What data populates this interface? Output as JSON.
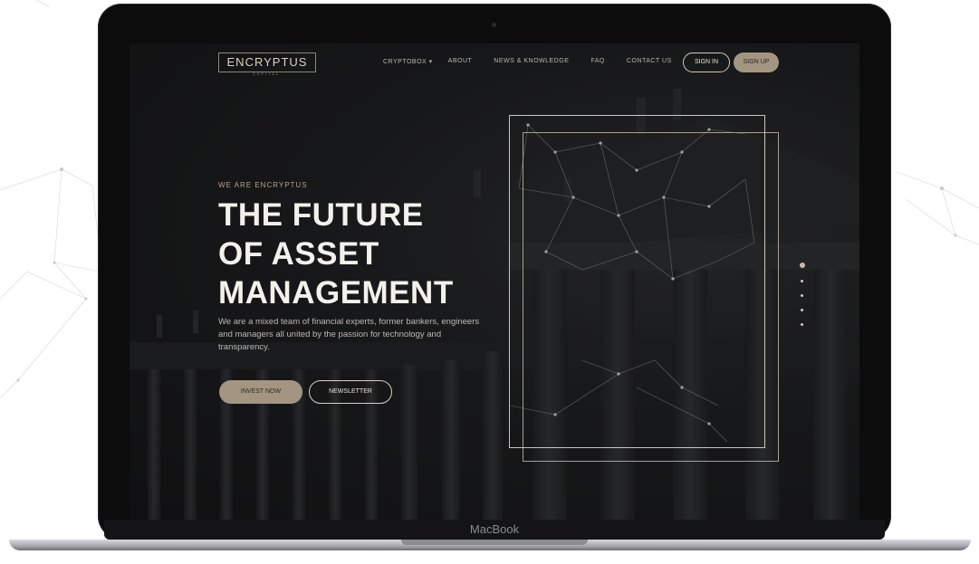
{
  "site": {
    "logo": "ENCRYPTUS",
    "logo_sub": "CAPITAL",
    "nav": [
      "CRYPTOBOX ▾",
      "ABOUT",
      "NEWS & KNOWLEDGE",
      "FAQ",
      "CONTACT US"
    ],
    "sign_in": "SIGN IN",
    "sign_up": "SIGN UP"
  },
  "hero": {
    "tagline": "WE ARE ENCRYPTUS",
    "headline": [
      "THE FUTURE",
      "OF ASSET",
      "MANAGEMENT"
    ],
    "description": "We are a mixed team of financial experts, former bankers, engineers and managers all united by the passion for technology and transparency.",
    "invest_button": "INVEST NOW",
    "newsletter_button": "NEWSLETTER"
  },
  "slider": {
    "count": 5,
    "active_index": 0
  },
  "device": {
    "label": "MacBook"
  },
  "colors": {
    "accent": "#a39582",
    "background": "#151618",
    "text": "#f3f1ec"
  }
}
